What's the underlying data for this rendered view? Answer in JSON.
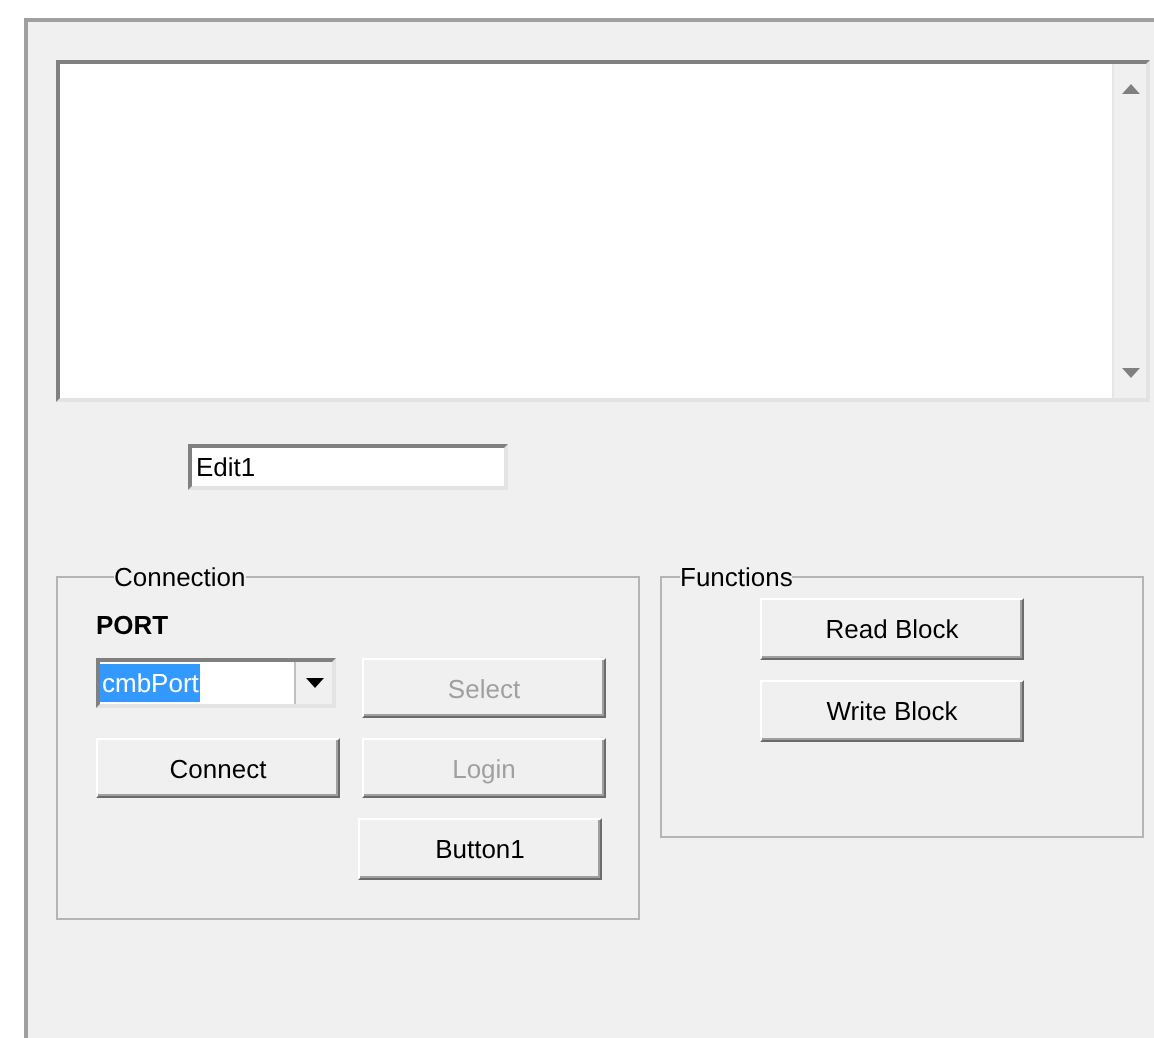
{
  "edit": {
    "value": "Edit1"
  },
  "connection": {
    "title": "Connection",
    "port_label": "PORT",
    "port": {
      "value": "cmbPort",
      "text_selected": true
    },
    "buttons": [
      {
        "label": "Select",
        "disabled": true
      },
      {
        "label": "Connect",
        "disabled": false
      },
      {
        "label": "Login",
        "disabled": true
      },
      {
        "label": "Button1",
        "disabled": false
      }
    ]
  },
  "functions": {
    "title": "Functions",
    "buttons": [
      {
        "label": "Read Block",
        "disabled": false
      },
      {
        "label": "Write Block",
        "disabled": false
      }
    ]
  }
}
